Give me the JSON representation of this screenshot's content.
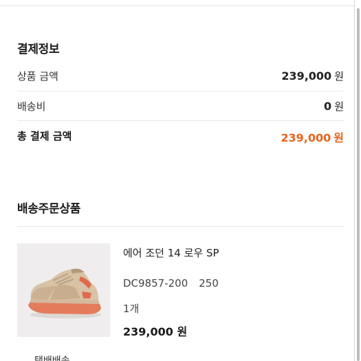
{
  "payment": {
    "title": "결제정보",
    "rows": [
      {
        "label": "상품 금액",
        "amount": "239,000",
        "unit": "원"
      },
      {
        "label": "배송비",
        "amount": "0",
        "unit": "원"
      }
    ],
    "total": {
      "label": "총 결제 금액",
      "amount": "239,000",
      "unit": "원"
    }
  },
  "shipping_items": {
    "title": "배송주문상품",
    "items": [
      {
        "name": "에어 조던 14 로우 SP",
        "model": "DC9857-200",
        "size": "250",
        "quantity": "1개",
        "price": "239,000 원"
      }
    ],
    "next_label": "택배배송"
  },
  "colors": {
    "accent": "#e8641f",
    "text": "#222222",
    "divider": "#e6e6e6"
  }
}
